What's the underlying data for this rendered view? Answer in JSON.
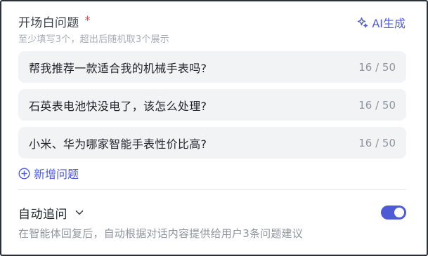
{
  "header": {
    "title": "开场白问题",
    "required_mark": "*",
    "subtitle": "至少填写3个，超出后随机取3个展示",
    "ai_button_label": "AI生成",
    "ai_icon": "sparkle-icon"
  },
  "questions": [
    {
      "text": "帮我推荐一款适合我的机械手表吗?",
      "count": "16 / 50"
    },
    {
      "text": "石英表电池快没电了，该怎么处理?",
      "count": "16 / 50"
    },
    {
      "text": "小米、华为哪家智能手表性价比高?",
      "count": "16 / 50"
    }
  ],
  "add_question": {
    "label": "新增问题",
    "icon": "plus-circle-icon"
  },
  "auto_followup": {
    "title": "自动追问",
    "icon": "chevron-down-icon",
    "description": "在智能体回复后，自动根据对话内容提供给用户3条问题建议",
    "enabled": true
  },
  "colors": {
    "accent": "#4f5bd5",
    "required": "#e5484d",
    "input_bg": "#f2f3f5"
  }
}
